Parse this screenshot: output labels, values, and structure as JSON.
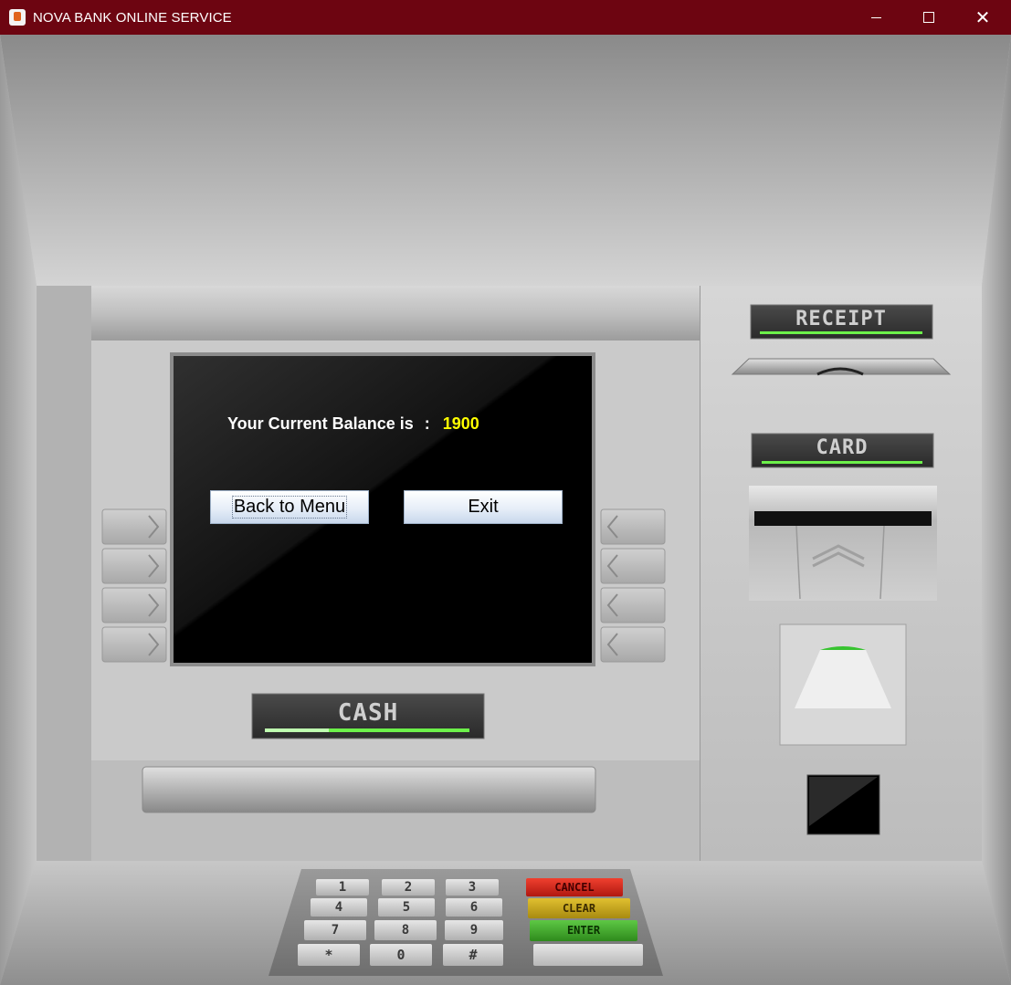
{
  "window": {
    "title": "NOVA BANK ONLINE SERVICE",
    "controls": {
      "minimize": "minimize-icon",
      "maximize": "maximize-icon",
      "close": "close-icon"
    }
  },
  "screen": {
    "balance_label": "Your Current Balance is",
    "separator": ":",
    "balance_value": "1900",
    "back_button": "Back to Menu",
    "exit_button": "Exit"
  },
  "atm": {
    "receipt_label": "RECEIPT",
    "card_label": "CARD",
    "cash_label": "CASH",
    "keypad": {
      "rows": [
        [
          "1",
          "2",
          "3",
          "CANCEL"
        ],
        [
          "4",
          "5",
          "6",
          "CLEAR"
        ],
        [
          "7",
          "8",
          "9",
          "ENTER"
        ],
        [
          "*",
          "0",
          "#",
          ""
        ]
      ]
    }
  },
  "colors": {
    "titlebar": "#6d0511",
    "balance_value": "#ffff00",
    "cancel_key": "#d9251c",
    "clear_key": "#c8a418",
    "enter_key": "#3fa028",
    "indicator": "#6cf04a"
  }
}
